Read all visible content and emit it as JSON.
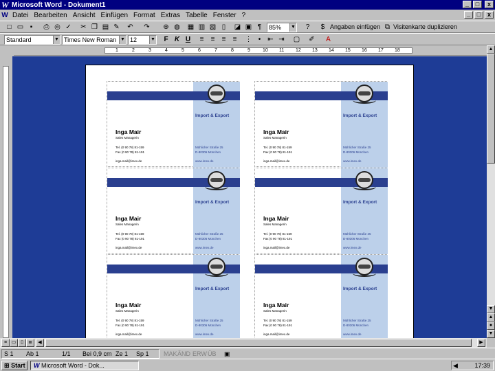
{
  "window": {
    "title": "Microsoft Word - Dokument1",
    "min_label": "_",
    "max_label": "□",
    "close_label": "x"
  },
  "menu": {
    "items": [
      "Datei",
      "Bearbeiten",
      "Ansicht",
      "Einfügen",
      "Format",
      "Extras",
      "Tabelle",
      "Fenster",
      "?"
    ]
  },
  "toolbar_standard": {
    "zoom": "85%",
    "insert_fields_label": "Angaben einfügen",
    "duplicate_card_label": "Visitenkarte duplizieren"
  },
  "toolbar_format": {
    "style": "Standard",
    "font": "Times New Roman",
    "size": "12",
    "bold_label": "F",
    "italic_label": "K",
    "underline_label": "U"
  },
  "ruler": {
    "ticks": [
      "1",
      "2",
      "3",
      "4",
      "5",
      "6",
      "7",
      "8",
      "9",
      "10",
      "11",
      "12",
      "13",
      "14",
      "15",
      "16",
      "17",
      "18"
    ]
  },
  "card": {
    "company": "Import & Export",
    "name": "Inga Mair",
    "title": "Sales Managerin",
    "tel": "Tel. (0 90 78) 81-159",
    "fax": "Fax (0 90 78) 81-191",
    "email": "inga.mail@imex.de",
    "street": "Mühlicher Straße 25",
    "city": "D-80306 München",
    "web": "www.imex.de"
  },
  "status": {
    "page": "S 1",
    "section": "Ab 1",
    "pages": "1/1",
    "position": "Bei 0,9 cm",
    "line": "Ze 1",
    "column": "Sp 1",
    "mak": "MAK",
    "ean": "ÄND",
    "erw": "ERW",
    "ub": "ÜB"
  },
  "taskbar": {
    "start_label": "Start",
    "task_label": "Microsoft Word - Dok...",
    "time": "17:39"
  },
  "colors": {
    "title_bar": "#000080",
    "workspace": "#1e3c96",
    "card_stripe": "#2a3f8f",
    "card_side": "#bcd0ea"
  }
}
